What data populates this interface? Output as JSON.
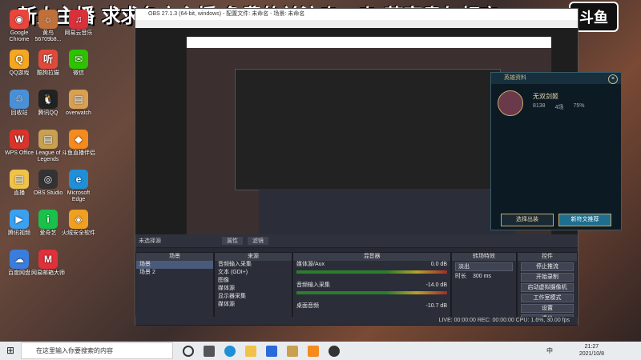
{
  "banner": {
    "text": "新人主播 求求各方主播 免费的关注走一走 荀富贵勿相忘",
    "logo": "斗鱼"
  },
  "desktop": {
    "icons": [
      {
        "label": "Google Chrome",
        "color": "#e8453c",
        "glyph": "◉"
      },
      {
        "label": "QQ游戏",
        "color": "#f5a623",
        "glyph": "Q"
      },
      {
        "label": "回收站",
        "color": "#4a90d9",
        "glyph": "♲"
      },
      {
        "label": "WPS Office",
        "color": "#d9342b",
        "glyph": "W"
      },
      {
        "label": "直播",
        "color": "#f0c24a",
        "glyph": "▤"
      },
      {
        "label": "腾讯视频",
        "color": "#3aa0f0",
        "glyph": "▶"
      },
      {
        "label": "百度网盘",
        "color": "#3b7ddd",
        "glyph": "☁"
      },
      {
        "label": "黄鸟 56709b8...",
        "color": "#c0703a",
        "glyph": "☼"
      },
      {
        "label": "酷狗拉猫",
        "color": "#e04a3a",
        "glyph": "听"
      },
      {
        "label": "腾讯QQ",
        "color": "#222222",
        "glyph": "🐧"
      },
      {
        "label": "League of Legends",
        "color": "#c8a050",
        "glyph": "▤"
      },
      {
        "label": "OBS Studio",
        "color": "#333333",
        "glyph": "◎"
      },
      {
        "label": "爱奇艺",
        "color": "#19c14b",
        "glyph": "i"
      },
      {
        "label": "网易邮箱大师",
        "color": "#e0303a",
        "glyph": "M"
      },
      {
        "label": "网易云音乐",
        "color": "#d9303a",
        "glyph": "♫"
      },
      {
        "label": "微信",
        "color": "#2dc100",
        "glyph": "✉"
      },
      {
        "label": "overwatch",
        "color": "#d8a050",
        "glyph": "▤"
      },
      {
        "label": "斗鱼直播伴侣",
        "color": "#f58a1f",
        "glyph": "◆"
      },
      {
        "label": "Microsoft Edge",
        "color": "#1f8fd8",
        "glyph": "e"
      },
      {
        "label": "火绒安全软件",
        "color": "#f0a020",
        "glyph": "◈"
      }
    ]
  },
  "obs": {
    "title": "OBS 27.1.3 (64-bit, windows) - 配置文件: 未命名 - 场景: 未命名",
    "source_bar": {
      "no_source": "未选择源",
      "properties": "属性",
      "filters": "滤镜"
    },
    "scenes": {
      "header": "场景",
      "items": [
        "场景",
        "场景 2"
      ]
    },
    "sources": {
      "header": "来源",
      "items": [
        "音频输入采集",
        "文本 (GDI+)",
        "图像",
        "媒体源",
        "显示器采集",
        "媒体源"
      ]
    },
    "mixer": {
      "header": "混音器",
      "channels": [
        {
          "name": "媒体源/Aux",
          "level": "0.0 dB"
        },
        {
          "name": "音频输入采集",
          "level": "-14.0 dB"
        },
        {
          "name": "桌面音频",
          "level": "-10.7 dB"
        }
      ]
    },
    "transitions": {
      "header": "转场特效",
      "type": "淡出",
      "duration_label": "时长",
      "duration": "300 ms"
    },
    "controls": {
      "header": "控件",
      "buttons": [
        "停止推流",
        "开始录制",
        "启动虚拟摄像机",
        "工作室模式",
        "设置",
        "退出"
      ]
    },
    "status": "LIVE: 00:00:00   REC: 00:00:00   CPU: 1.6%, 30.00 fps"
  },
  "lol": {
    "header": "英雄资料",
    "name": "无双剑姬",
    "stats": [
      {
        "label": "8138",
        "v": "4场"
      },
      {
        "label": "75%",
        "v": ""
      }
    ],
    "btn_left": "选择出装",
    "btn_right": "新符文推荐"
  },
  "taskbar": {
    "search_placeholder": "在这里输入你要搜索的内容",
    "time": "21:27",
    "date": "2021/10/8",
    "ime": "中"
  }
}
